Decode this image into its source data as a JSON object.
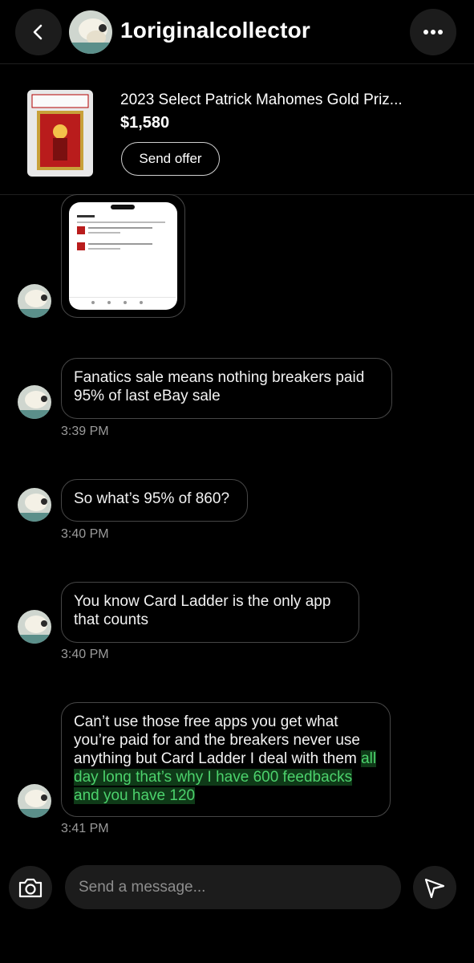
{
  "header": {
    "username": "1originalcollector",
    "back_icon": "chevron-left-icon",
    "more_icon": "more-horizontal-icon"
  },
  "listing": {
    "title": "2023 Select Patrick Mahomes Gold Priz...",
    "price": "$1,580",
    "offer_label": "Send offer"
  },
  "messages": [
    {
      "text": "Fanatics sale means nothing breakers paid 95% of last eBay sale",
      "time": "3:39 PM"
    },
    {
      "text": "So what’s 95% of 860?",
      "time": "3:40 PM"
    },
    {
      "text": "You know Card Ladder is the only app that counts",
      "time": "3:40 PM"
    },
    {
      "text_plain": "Can’t use those free apps you get what you’re paid for and the breakers never use anything but Card Ladder I deal with them",
      "text_highlight": "all day long that’s why I have 600 feedbacks and you have 120",
      "time": "3:41 PM"
    }
  ],
  "composer": {
    "placeholder": "Send a message...",
    "camera_icon": "camera-icon",
    "send_icon": "send-icon"
  },
  "colors": {
    "background": "#000000",
    "button_bg": "#1c1c1c",
    "bubble_border": "#464646",
    "highlight_text": "#4cd26c"
  }
}
